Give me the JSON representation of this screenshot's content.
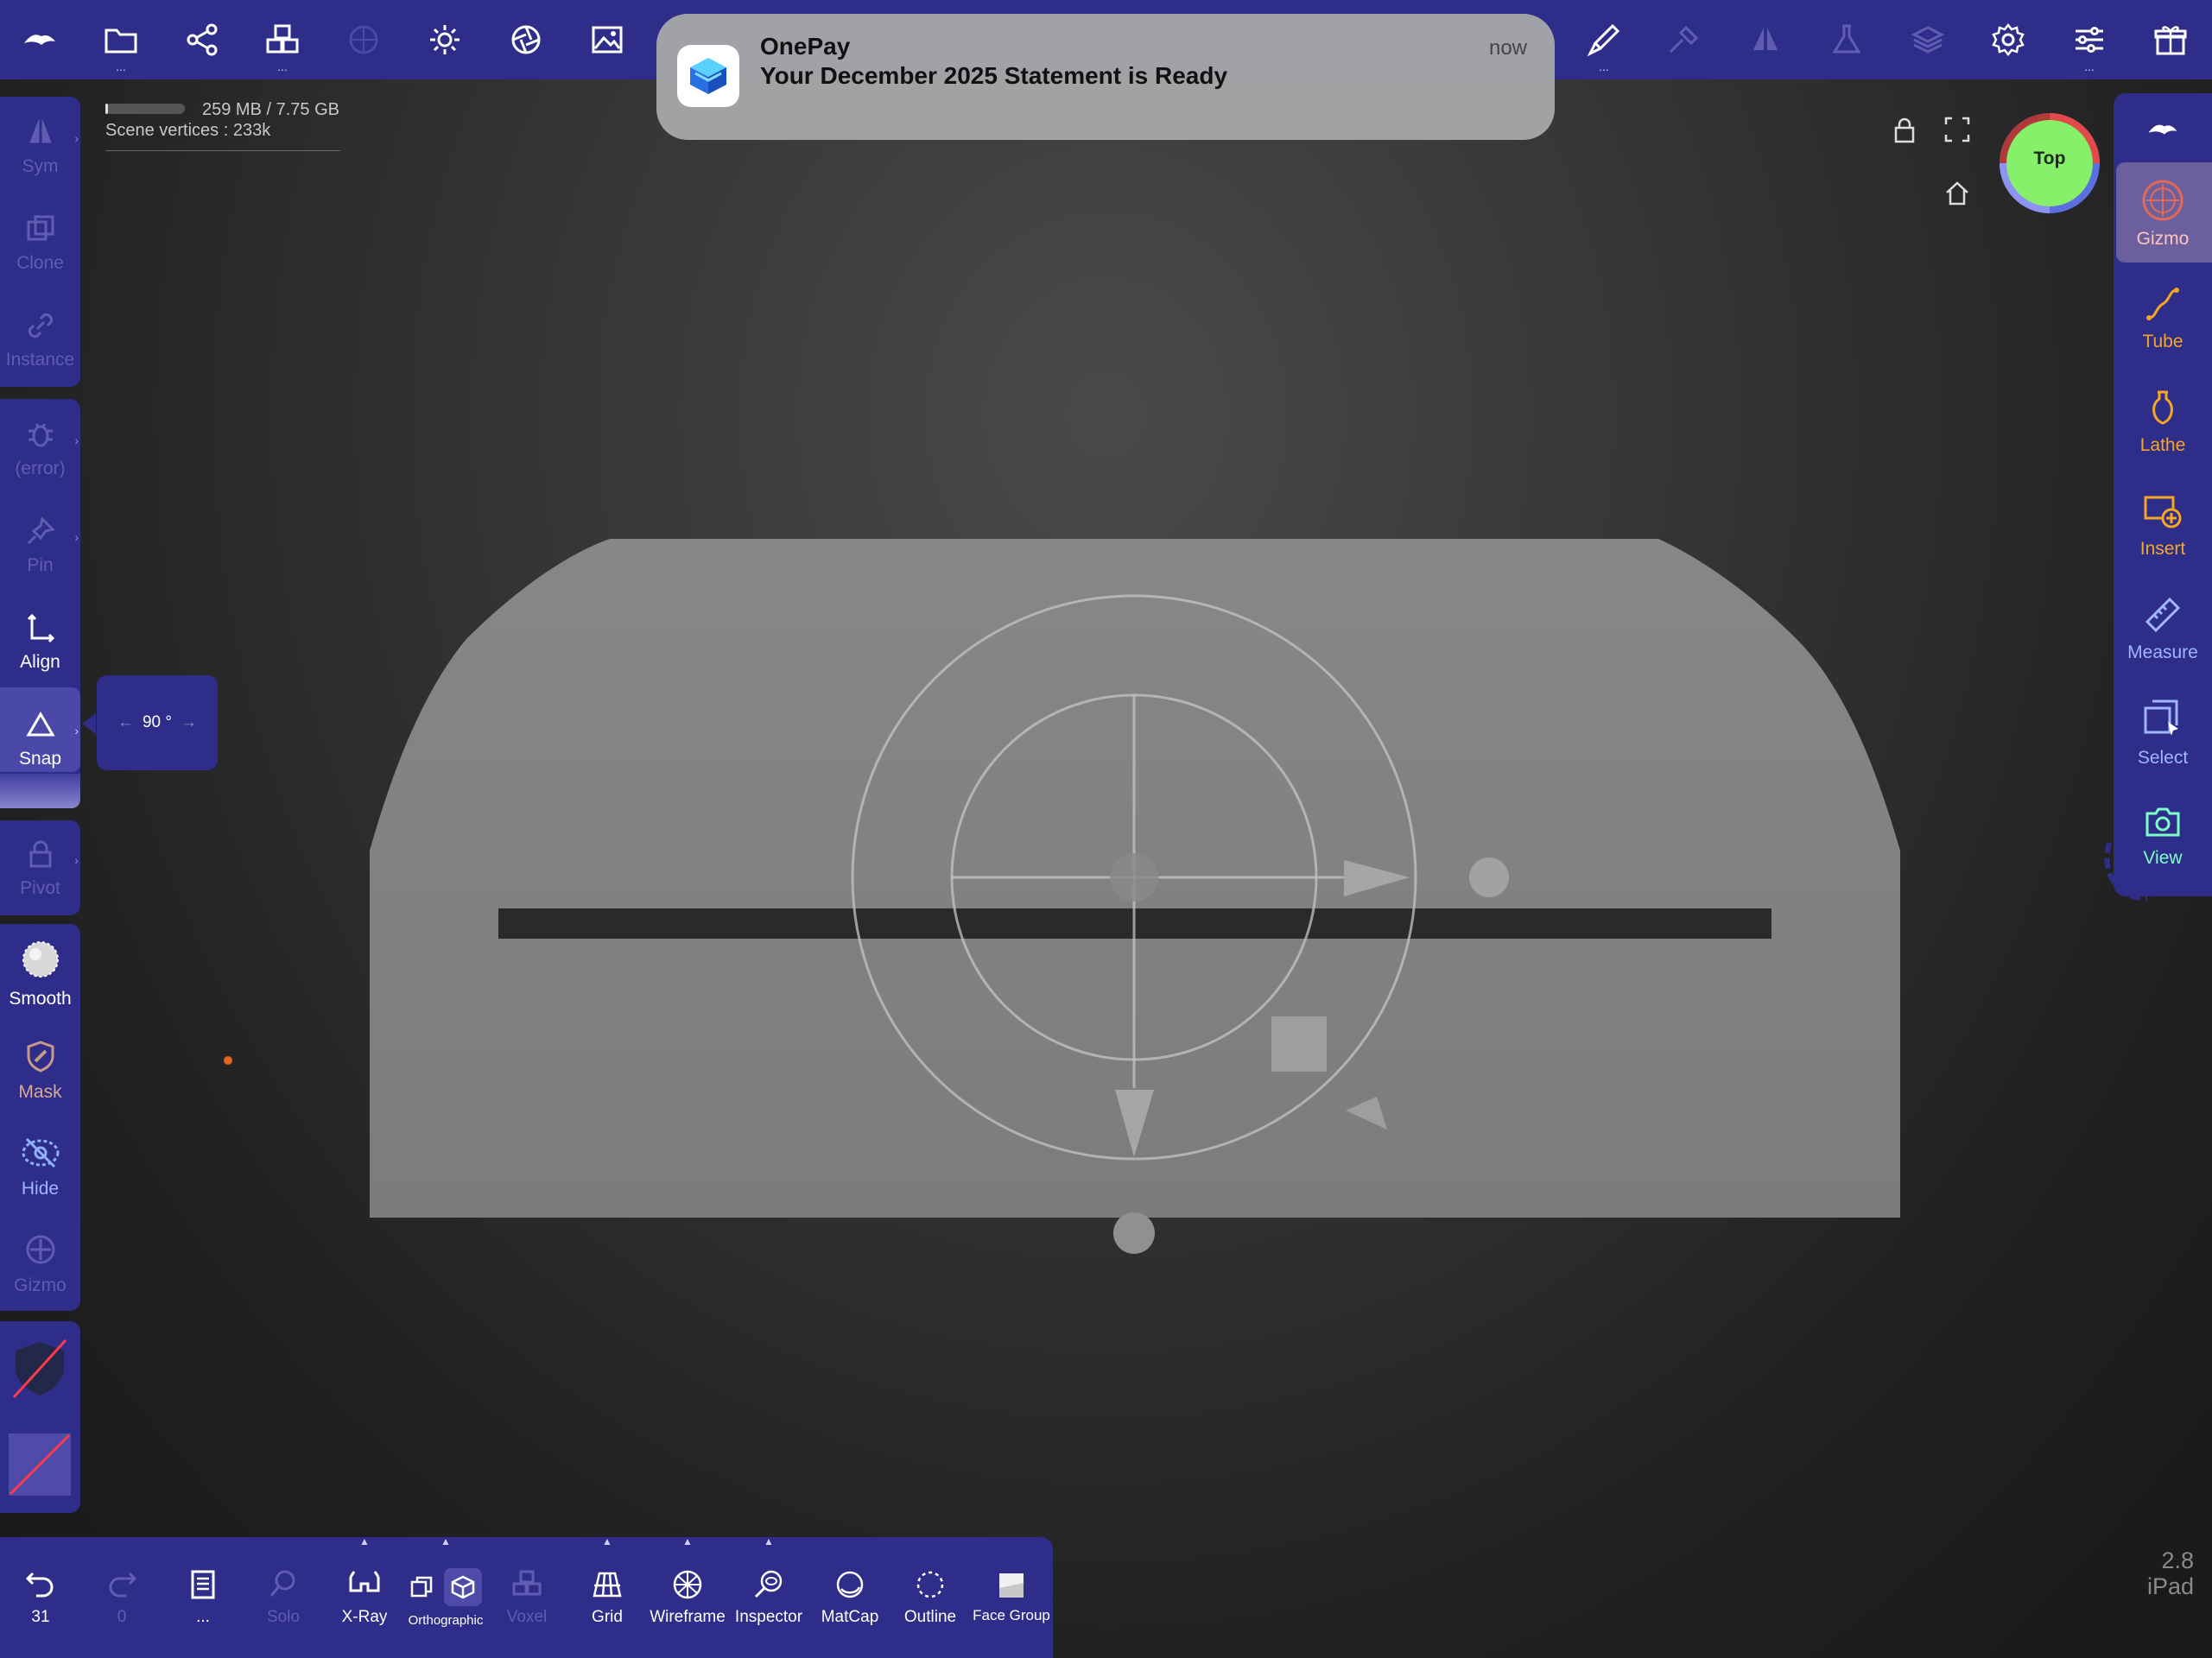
{
  "notification": {
    "app_name": "OnePay",
    "message": "Your December 2025 Statement is Ready",
    "time": "now"
  },
  "top_toolbar": {
    "icons": [
      "nomad-logo-icon",
      "folder-icon",
      "share-nodes-icon",
      "cubes-icon",
      "sphere-icon",
      "sun-icon",
      "aperture-icon",
      "image-icon",
      "brush-icon",
      "hammer-icon",
      "symmetry-icon",
      "flask-icon",
      "layers-icon",
      "gear-icon",
      "sliders-icon",
      "gift-icon"
    ]
  },
  "stats": {
    "memory": "259 MB / 7.75 GB",
    "memory_fraction": 0.03,
    "vertices_label": "Scene vertices :",
    "vertices_value": "233k"
  },
  "left_sidebar": {
    "items": [
      {
        "label": "Sym",
        "icon": "symmetry-icon",
        "enabled": false
      },
      {
        "label": "Clone",
        "icon": "clone-icon",
        "enabled": false
      },
      {
        "label": "Instance",
        "icon": "link-icon",
        "enabled": false
      },
      {
        "label": "(error)",
        "icon": "bug-icon",
        "enabled": false
      },
      {
        "label": "Pin",
        "icon": "pin-icon",
        "enabled": false
      },
      {
        "label": "Align",
        "icon": "align-icon",
        "enabled": true
      },
      {
        "label": "Snap",
        "icon": "triangle-icon",
        "enabled": true,
        "active": true
      },
      {
        "label": "Pivot",
        "icon": "lock-icon",
        "enabled": false
      },
      {
        "label": "Smooth",
        "icon": "smooth-icon",
        "enabled": true
      },
      {
        "label": "Mask",
        "icon": "mask-shield-icon",
        "enabled": true
      },
      {
        "label": "Hide",
        "icon": "hide-icon",
        "enabled": true
      },
      {
        "label": "Gizmo",
        "icon": "gizmo-icon",
        "enabled": false
      }
    ]
  },
  "snap_popup": {
    "value": "90 °",
    "left_arrow": "←",
    "right_arrow": "→"
  },
  "right_sidebar": {
    "items": [
      {
        "label": "Gizmo",
        "icon": "gizmo-icon",
        "active": true
      },
      {
        "label": "Tube",
        "icon": "tube-icon"
      },
      {
        "label": "Lathe",
        "icon": "lathe-icon"
      },
      {
        "label": "Insert",
        "icon": "insert-icon"
      },
      {
        "label": "Measure",
        "icon": "ruler-icon"
      },
      {
        "label": "Select",
        "icon": "select-icon"
      },
      {
        "label": "View",
        "icon": "camera-icon"
      }
    ]
  },
  "view_cube": {
    "label": "Top"
  },
  "bottom_bar": {
    "undo_count": "31",
    "redo_count": "0",
    "items": [
      {
        "label": "...",
        "icon": "book-icon"
      },
      {
        "label": "Solo",
        "icon": "search-icon",
        "enabled": false
      },
      {
        "label": "X-Ray",
        "icon": "glasses-icon"
      },
      {
        "label": "Orthographic",
        "icon": "cube-icon"
      },
      {
        "label": "Voxel",
        "icon": "voxel-icon",
        "enabled": false
      },
      {
        "label": "Grid",
        "icon": "grid-icon"
      },
      {
        "label": "Wireframe",
        "icon": "wireframe-icon"
      },
      {
        "label": "Inspector",
        "icon": "inspector-icon"
      },
      {
        "label": "MatCap",
        "icon": "matcap-icon"
      },
      {
        "label": "Outline",
        "icon": "outline-icon"
      },
      {
        "label": "Face Group",
        "icon": "face-group-icon"
      }
    ]
  },
  "version": {
    "number": "2.8",
    "device": "iPad"
  },
  "colors": {
    "toolbar": "#2f2d8a",
    "accent_orange": "#f5a623",
    "view_green": "#7dffc8",
    "viewcube_green": "#86f06a"
  }
}
